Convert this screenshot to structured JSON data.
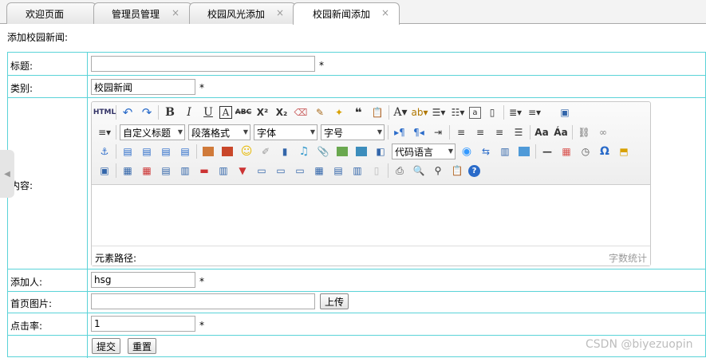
{
  "tabs": [
    {
      "label": "欢迎页面",
      "closable": false
    },
    {
      "label": "管理员管理",
      "closable": true
    },
    {
      "label": "校园风光添加",
      "closable": true
    },
    {
      "label": "校园新闻添加",
      "closable": true,
      "active": true
    }
  ],
  "close_glyph": "×",
  "section_title": "添加校园新闻:",
  "form": {
    "title_label": "标题:",
    "title_value": "",
    "category_label": "类别:",
    "category_value": "校园新闻",
    "content_label": "内容:",
    "adder_label": "添加人:",
    "adder_value": "hsg",
    "image_label": "首页图片:",
    "image_value": "",
    "upload_button": "上传",
    "clicks_label": "点击率:",
    "clicks_value": "1",
    "required_mark": "*",
    "submit_button": "提交",
    "reset_button": "重置"
  },
  "editor": {
    "combos": {
      "custom_heading": "自定义标题",
      "paragraph_format": "段落格式",
      "font_family": "字体",
      "font_size": "字号",
      "code_language": "代码语言"
    },
    "path_label": "元素路径:",
    "word_count": "字数统计"
  },
  "watermark": "CSDN @biyezuopin",
  "colors": {
    "border": "#5ad3d8",
    "tab_border": "#aaaaaa"
  }
}
